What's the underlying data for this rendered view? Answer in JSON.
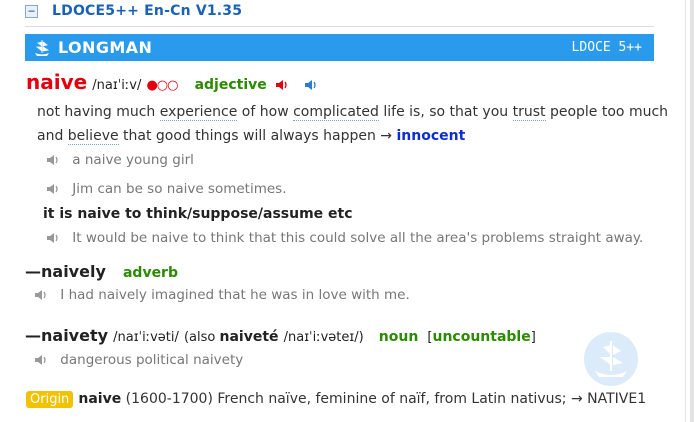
{
  "header": {
    "collapse": "−",
    "title": "LDOCE5++ En-Cn V1.35"
  },
  "banner": {
    "brand": "LONGMAN",
    "version": "LDOCE 5++"
  },
  "entry": {
    "headword": "naive",
    "pron": "/naɪˈiːv/",
    "freq": "●○○",
    "pos": "adjective",
    "def_a": "not having much ",
    "def_w1": "experience",
    "def_b": " of how ",
    "def_w2": "complicated",
    "def_c": " life is, so that you ",
    "def_w3": "trust",
    "def_d": " people too much",
    "def_e": "and ",
    "def_w4": "believe",
    "def_f": " that good things will always happen → ",
    "def_xref": "innocent",
    "examples": [
      "a naive young girl",
      "Jim can be so naive sometimes."
    ],
    "collocation": "it is naive to think/suppose/assume etc",
    "collocation_example": "It would be naive to think that this could solve all the area's problems straight away."
  },
  "runons": [
    {
      "word": "naively",
      "pos": "adverb",
      "example": "I had naively imagined that he was in love with me."
    },
    {
      "word": "naivety",
      "pron": "/naɪˈiːvəti/",
      "also_open": "(also ",
      "variant": "naiveté",
      "variant_pron": "/naɪˈiːvəteɪ/)",
      "pos": "noun",
      "grammar_open": "[",
      "grammar": "uncountable",
      "grammar_close": "]",
      "example": "dangerous political naivety"
    }
  ],
  "origin": {
    "label": "Origin",
    "word": "naive",
    "text": " (1600-1700) French naïve, feminine of naïf, from Latin nativus; → NATIVE1"
  },
  "colors": {
    "banner": "#2a9bec",
    "headword": "#e3000f",
    "pos": "#2a8a00",
    "xref": "#0b2dd1",
    "origin_tag": "#f2c200"
  }
}
